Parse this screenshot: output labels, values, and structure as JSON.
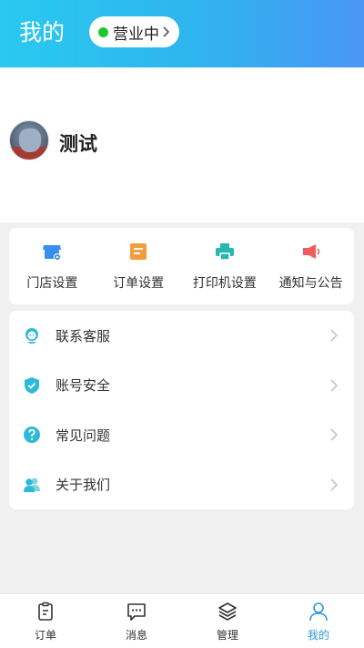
{
  "header": {
    "title": "我的",
    "status": {
      "label": "营业中",
      "dot_color": "#1ec72e"
    },
    "gradient": [
      "#29c9f0",
      "#4a96f5"
    ]
  },
  "profile": {
    "username": "测试"
  },
  "quick_actions": [
    {
      "label": "门店设置",
      "icon": "store-settings-icon",
      "color": "#3a8ef0"
    },
    {
      "label": "订单设置",
      "icon": "order-settings-icon",
      "color": "#f39c3d"
    },
    {
      "label": "打印机设置",
      "icon": "printer-icon",
      "color": "#26b8b0"
    },
    {
      "label": "通知与公告",
      "icon": "megaphone-icon",
      "color": "#ee5e5e"
    }
  ],
  "menu": [
    {
      "label": "联系客服",
      "icon": "customer-service-icon"
    },
    {
      "label": "账号安全",
      "icon": "shield-icon"
    },
    {
      "label": "常见问题",
      "icon": "question-icon"
    },
    {
      "label": "关于我们",
      "icon": "people-icon"
    }
  ],
  "tabbar": {
    "active_color": "#2a9bd8",
    "items": [
      {
        "label": "订单",
        "icon": "clipboard-icon"
      },
      {
        "label": "消息",
        "icon": "chat-icon"
      },
      {
        "label": "管理",
        "icon": "layers-icon"
      },
      {
        "label": "我的",
        "icon": "user-icon",
        "active": true
      }
    ]
  }
}
